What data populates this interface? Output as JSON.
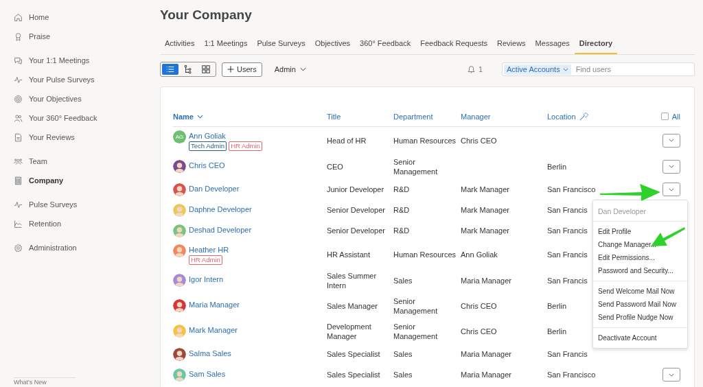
{
  "sidebar": {
    "groups": [
      [
        {
          "label": "Home",
          "selected": false
        },
        {
          "label": "Praise",
          "selected": false
        }
      ],
      [
        {
          "label": "Your 1:1 Meetings",
          "selected": false
        },
        {
          "label": "Your Pulse Surveys",
          "selected": false
        },
        {
          "label": "Your Objectives",
          "selected": false
        },
        {
          "label": "Your 360° Feedback",
          "selected": false
        },
        {
          "label": "Your Reviews",
          "selected": false
        }
      ],
      [
        {
          "label": "Team",
          "selected": false
        },
        {
          "label": "Company",
          "selected": true
        }
      ],
      [
        {
          "label": "Pulse Surveys",
          "selected": false
        },
        {
          "label": "Retention",
          "selected": false
        }
      ],
      [
        {
          "label": "Administration",
          "selected": false
        }
      ]
    ],
    "footer": "What's New"
  },
  "page_title": "Your Company",
  "tabs": [
    {
      "label": "Activities",
      "selected": false
    },
    {
      "label": "1:1 Meetings",
      "selected": false
    },
    {
      "label": "Pulse Surveys",
      "selected": false
    },
    {
      "label": "Objectives",
      "selected": false
    },
    {
      "label": "360° Feedback",
      "selected": false
    },
    {
      "label": "Feedback Requests",
      "selected": false
    },
    {
      "label": "Reviews",
      "selected": false
    },
    {
      "label": "Messages",
      "selected": false
    },
    {
      "label": "Directory",
      "selected": true
    }
  ],
  "toolbar": {
    "view_modes": [
      {
        "selected": true
      },
      {
        "selected": false
      },
      {
        "selected": false
      }
    ],
    "add_button": "Users",
    "role_filter": "Admin",
    "notifications": "1",
    "account_filter": "Active Accounts",
    "search": {
      "placeholder": "Find users"
    }
  },
  "table": {
    "columns": [
      "Name",
      "Title",
      "Department",
      "Manager",
      "Location"
    ],
    "select_all": {
      "label": "All",
      "checked": false
    },
    "rows": [
      {
        "name": "Ann Goliak",
        "avatar": {
          "kind": "initials",
          "text": "AG",
          "color": "#6cc070"
        },
        "tags": [
          {
            "label": "Tech Admin",
            "color": "#2b5f8a"
          },
          {
            "label": "HR Admin",
            "color": "#e0666e"
          }
        ],
        "title": "Head of HR",
        "department": "Human Resources",
        "manager": "Chris CEO",
        "location": "",
        "menu_button": true
      },
      {
        "name": "Chris CEO",
        "avatar": {
          "kind": "figure",
          "color": "#7a4a8c"
        },
        "tags": [],
        "title": "CEO",
        "department": "Senior Management",
        "manager": "",
        "location": "Berlin",
        "menu_button": true
      },
      {
        "name": "Dan Developer",
        "avatar": {
          "kind": "figure",
          "color": "#d9534f"
        },
        "tags": [],
        "title": "Junior Developer",
        "department": "R&D",
        "manager": "Mark Manager",
        "location": "San Francisco",
        "menu_button": true
      },
      {
        "name": "Daphne Developer",
        "avatar": {
          "kind": "figure",
          "color": "#e8c95a"
        },
        "tags": [],
        "title": "Senior Developer",
        "department": "R&D",
        "manager": "Mark Manager",
        "location": "San Francis",
        "menu_button": false
      },
      {
        "name": "Deshad Developer",
        "avatar": {
          "kind": "figure",
          "color": "#7bc47f"
        },
        "tags": [],
        "title": "Senior Developer",
        "department": "R&D",
        "manager": "Mark Manager",
        "location": "San Francis",
        "menu_button": false
      },
      {
        "name": "Heather HR",
        "avatar": {
          "kind": "figure",
          "color": "#f08a5d"
        },
        "tags": [
          {
            "label": "HR Admin",
            "color": "#e0666e"
          }
        ],
        "title": "HR Assistant",
        "department": "Human Resources",
        "manager": "Ann Goliak",
        "location": "San Francis",
        "menu_button": false
      },
      {
        "name": "Igor Intern",
        "avatar": {
          "kind": "figure",
          "color": "#a58bd6"
        },
        "tags": [],
        "title": "Sales Summer Intern",
        "department": "Sales",
        "manager": "Maria Manager",
        "location": "San Francis",
        "menu_button": false
      },
      {
        "name": "Maria Manager",
        "avatar": {
          "kind": "figure",
          "color": "#d9343a"
        },
        "tags": [],
        "title": "Sales Manager",
        "department": "Senior Management",
        "manager": "Chris CEO",
        "location": "Berlin",
        "menu_button": false
      },
      {
        "name": "Mark Manager",
        "avatar": {
          "kind": "figure",
          "color": "#f5c242"
        },
        "tags": [],
        "title": "Development Manager",
        "department": "Senior Management",
        "manager": "Chris CEO",
        "location": "Berlin",
        "menu_button": false
      },
      {
        "name": "Salma Sales",
        "avatar": {
          "kind": "figure",
          "color": "#9c4a3c"
        },
        "tags": [],
        "title": "Sales Specialist",
        "department": "Sales",
        "manager": "Maria Manager",
        "location": "San Francis",
        "menu_button": false
      },
      {
        "name": "Sam Sales",
        "avatar": {
          "kind": "figure",
          "color": "#6cc6a0"
        },
        "tags": [],
        "title": "Sales Specialist",
        "department": "Sales",
        "manager": "Maria Manager",
        "location": "San Francisco",
        "menu_button": true
      }
    ]
  },
  "row_menu": {
    "header": "Dan Developer",
    "sections": [
      [
        "Edit Profile",
        "Change Manager...",
        "Edit Permissions...",
        "Password and Security..."
      ],
      [
        "Send Welcome Mail Now",
        "Send Password Mail Now",
        "Send Profile Nudge Now"
      ],
      [
        "Deactivate Account"
      ]
    ]
  }
}
